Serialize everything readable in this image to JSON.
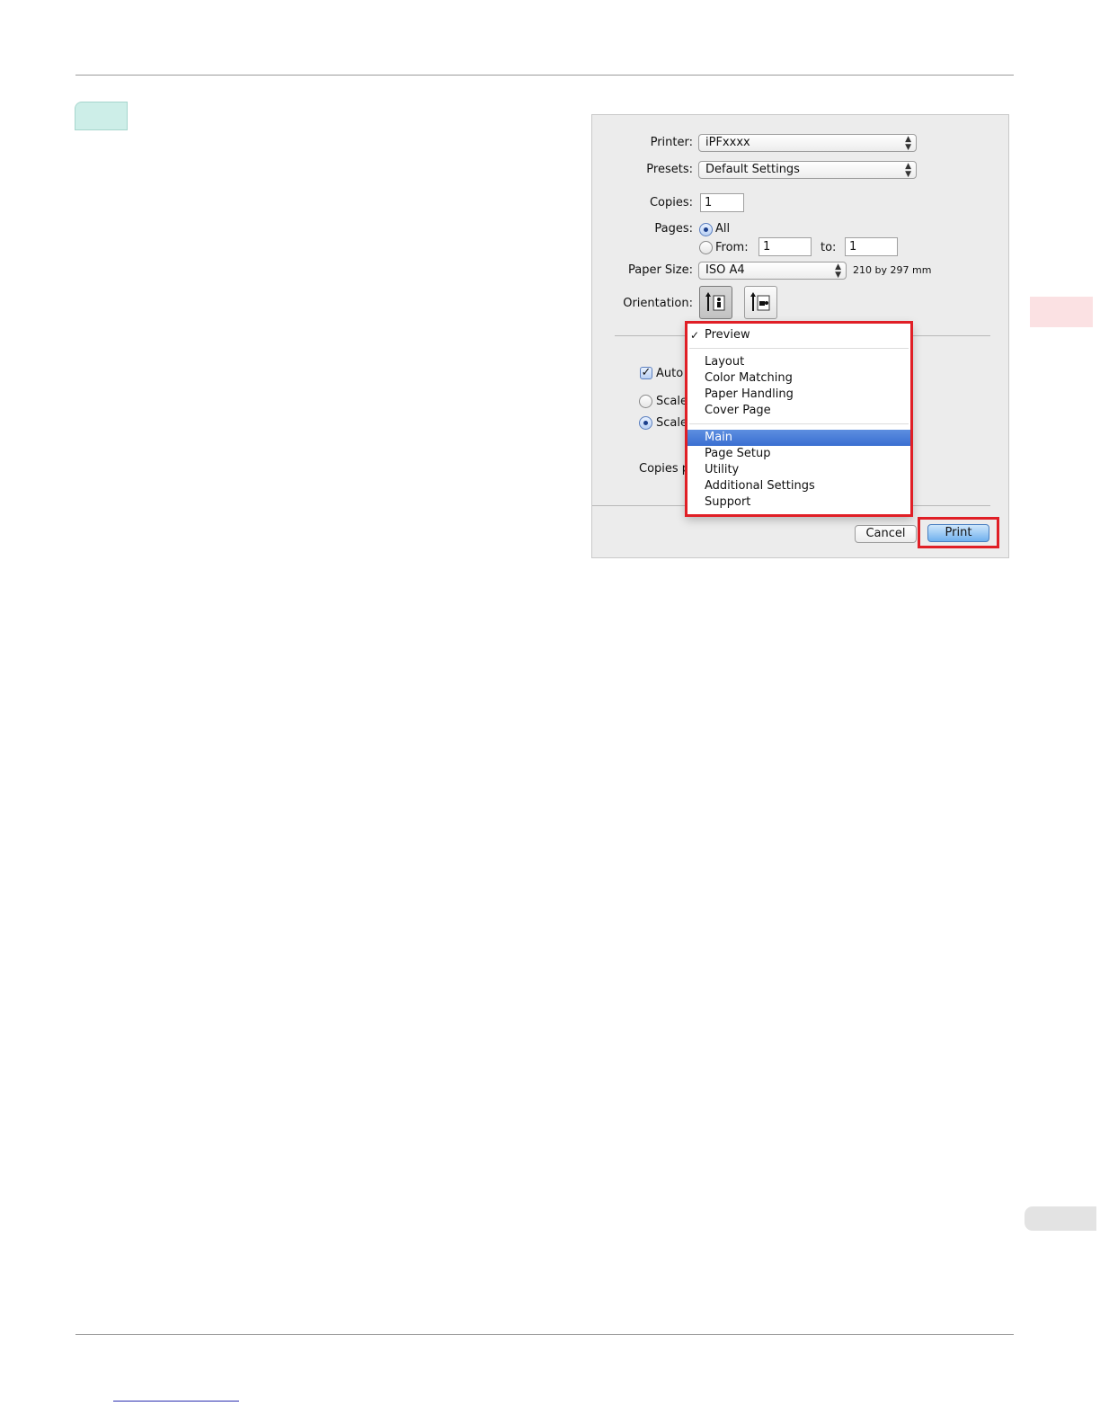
{
  "dialog": {
    "printer": {
      "label": "Printer:",
      "value": "iPFxxxx"
    },
    "presets": {
      "label": "Presets:",
      "value": "Default Settings"
    },
    "copies": {
      "label": "Copies:",
      "value": "1"
    },
    "pages": {
      "label": "Pages:",
      "all_label": "All",
      "from_label": "From:",
      "from_value": "1",
      "to_label": "to:",
      "to_value": "1"
    },
    "paper_size": {
      "label": "Paper Size:",
      "value": "ISO A4",
      "dimensions": "210 by 297 mm"
    },
    "orientation": {
      "label": "Orientation:"
    },
    "partial": {
      "auto_label": "Auto",
      "scale1_label": "Scale",
      "scale2_label": "Scale",
      "copies_per_label": "Copies p"
    },
    "buttons": {
      "cancel": "Cancel",
      "print": "Print"
    }
  },
  "menu": {
    "checked_item": "Preview",
    "group1": [
      "Layout",
      "Color Matching",
      "Paper Handling",
      "Cover Page"
    ],
    "selected_item": "Main",
    "group2": [
      "Page Setup",
      "Utility",
      "Additional Settings",
      "Support"
    ]
  },
  "colors": {
    "highlight": "#e01f26",
    "menu_selection": "#3a6fd1",
    "step_tab": "#cdeee8",
    "side_tab": "#fbe1e3"
  }
}
